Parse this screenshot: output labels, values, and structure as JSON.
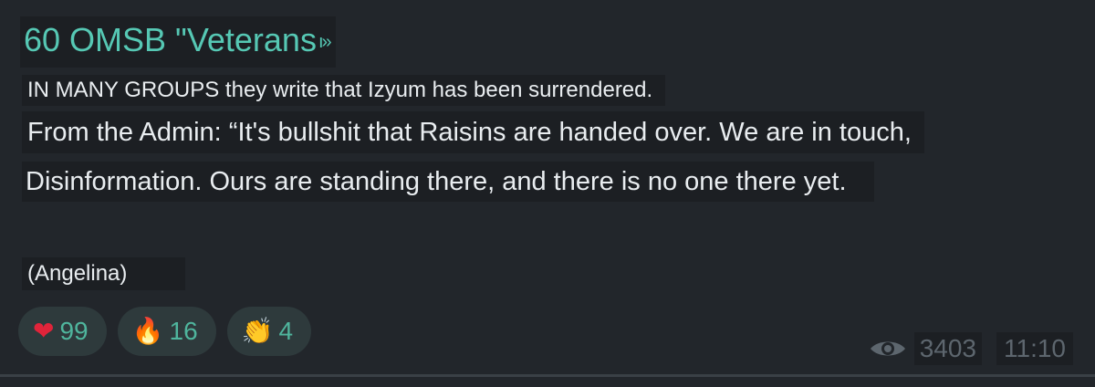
{
  "channel": {
    "title": "60 OMSB \"Veterans",
    "title_suffix_icon": "forward-arrows-icon",
    "title_suffix": "ı»"
  },
  "message": {
    "lines": [
      "IN MANY GROUPS they write that Izyum has been surrendered.",
      "From the Admin: “It's bullshit that Raisins are handed over. We are in touch,",
      "Disinformation. Ours are standing there, and there is no one there yet.",
      "(Angelina)"
    ]
  },
  "reactions": [
    {
      "icon": "heart-icon",
      "glyph": "❤",
      "count": "99"
    },
    {
      "icon": "fire-icon",
      "glyph": "🔥",
      "count": "16"
    },
    {
      "icon": "clap-icon",
      "glyph": "👏",
      "count": "4"
    }
  ],
  "meta": {
    "views": "3403",
    "time": "11:10",
    "views_icon": "eye-icon"
  },
  "colors": {
    "background": "#22262b",
    "accent": "#56c8b4",
    "text": "#e9edf0",
    "muted": "#5d666e"
  }
}
